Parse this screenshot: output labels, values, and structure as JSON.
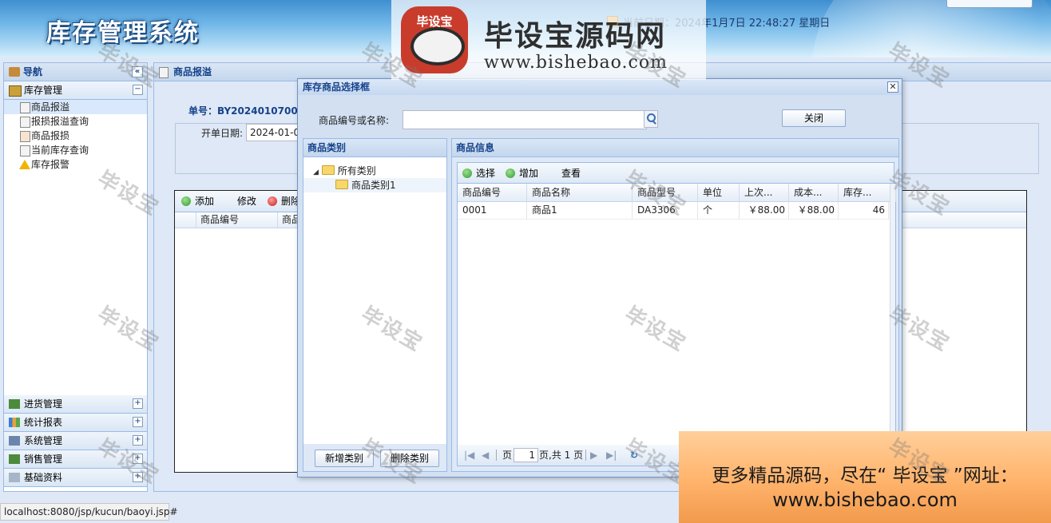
{
  "header": {
    "title": "库存管理系统",
    "datetime": "当前日期：2024年1月7日 22:48:27 星期日"
  },
  "nav": {
    "title": "导航",
    "sections": [
      {
        "label": "库存管理",
        "expanded": true,
        "items": [
          "商品报溢",
          "报损报溢查询",
          "商品报损",
          "当前库存查询",
          "库存报警"
        ]
      },
      {
        "label": "进货管理"
      },
      {
        "label": "统计报表"
      },
      {
        "label": "系统管理"
      },
      {
        "label": "销售管理"
      },
      {
        "label": "基础资料"
      }
    ]
  },
  "main": {
    "title": "商品报溢",
    "order_no": "单号：BY202401070001",
    "date_label": "开单日期:",
    "date_value": "2024-01-07",
    "toolbar": {
      "add": "添加",
      "edit": "修改",
      "delete": "删除"
    },
    "columns": [
      "商品编号",
      "商品"
    ]
  },
  "dialog": {
    "title": "库存商品选择框",
    "search_label": "商品编号或名称:",
    "search_value": "",
    "close_button": "关闭",
    "category_panel": {
      "title": "商品类别",
      "root": "所有类别",
      "child": "商品类别1",
      "add_button": "新增类别",
      "delete_button": "删除类别"
    },
    "product_panel": {
      "title": "商品信息",
      "toolbar": {
        "select": "选择",
        "add": "增加",
        "view": "查看"
      },
      "columns": [
        "商品编号",
        "商品名称",
        "商品型号",
        "单位",
        "上次...",
        "成本...",
        "库存..."
      ],
      "rows": [
        [
          "0001",
          "商品1",
          "DA3306",
          "个",
          "￥88.00",
          "￥88.00",
          "46"
        ]
      ],
      "pager": {
        "page_label": "页",
        "page_value": "1",
        "total": "页,共 1 页"
      }
    }
  },
  "status_bar": "localhost:8080/jsp/kucun/baoyi.jsp#",
  "watermark": {
    "text": "毕设宝",
    "logo_badge": "毕设宝",
    "logo_big": "毕设宝源码网",
    "logo_url": "www.bishebao.com",
    "promo_line1": "更多精品源码，尽在“ 毕设宝 ”网址：",
    "promo_line2": "www.bishebao.com"
  },
  "colors": {
    "accent": "#15428b",
    "border": "#99bbe8",
    "panel_bg": "#dfe8f6"
  }
}
